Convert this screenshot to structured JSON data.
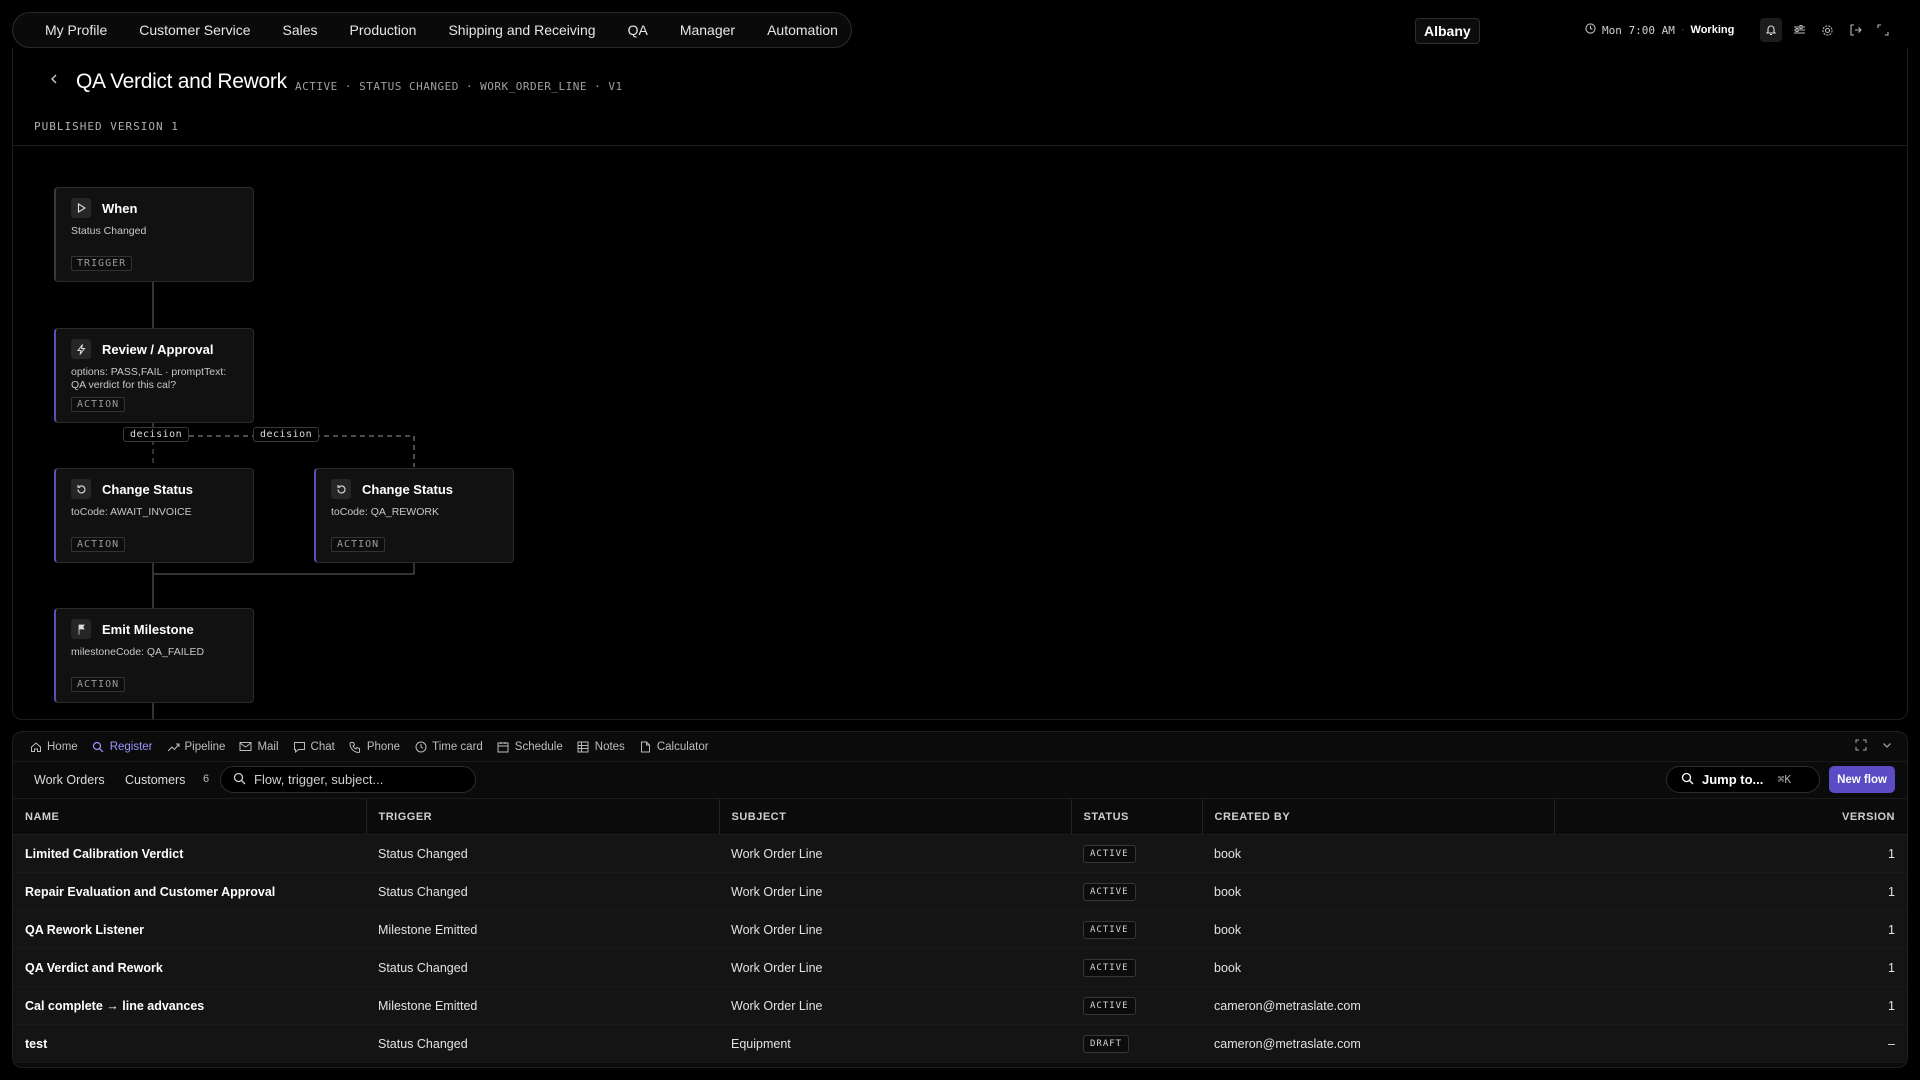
{
  "topnav": {
    "items": [
      "My Profile",
      "Customer Service",
      "Sales",
      "Production",
      "Shipping and Receiving",
      "QA",
      "Manager",
      "Automation"
    ],
    "location": "Albany",
    "clock": "Mon 7:00 AM",
    "separator": "·",
    "shift_status": "Working"
  },
  "flow": {
    "title": "QA Verdict and Rework",
    "meta": "ACTIVE · STATUS CHANGED · WORK_ORDER_LINE · V1",
    "published": "PUBLISHED VERSION 1",
    "nodes": [
      {
        "title": "When",
        "desc": "Status Changed",
        "tag": "TRIGGER",
        "icon": "play-icon"
      },
      {
        "title": "Review / Approval",
        "desc": "options: PASS,FAIL · promptText: QA verdict for this cal?",
        "tag": "ACTION",
        "icon": "bolt-icon"
      },
      {
        "title": "Change Status",
        "desc": "toCode: AWAIT_INVOICE",
        "tag": "ACTION",
        "icon": "refresh-icon"
      },
      {
        "title": "Change Status",
        "desc": "toCode: QA_REWORK",
        "tag": "ACTION",
        "icon": "refresh-icon"
      },
      {
        "title": "Emit Milestone",
        "desc": "milestoneCode: QA_FAILED",
        "tag": "ACTION",
        "icon": "flag-icon"
      }
    ],
    "edge_labels": [
      "decision",
      "decision"
    ]
  },
  "dock": {
    "tabs": [
      {
        "label": "Home",
        "icon": "home-icon"
      },
      {
        "label": "Register",
        "icon": "search-icon"
      },
      {
        "label": "Pipeline",
        "icon": "trend-icon"
      },
      {
        "label": "Mail",
        "icon": "mail-icon"
      },
      {
        "label": "Chat",
        "icon": "chat-icon"
      },
      {
        "label": "Phone",
        "icon": "phone-icon"
      },
      {
        "label": "Time card",
        "icon": "clock-icon"
      },
      {
        "label": "Schedule",
        "icon": "calendar-icon"
      },
      {
        "label": "Notes",
        "icon": "grid-icon"
      },
      {
        "label": "Calculator",
        "icon": "file-icon"
      }
    ],
    "active_tab": "Register",
    "filters": [
      "Work Orders",
      "Customers"
    ],
    "count": "6",
    "search_placeholder": "Flow, trigger, subject...",
    "jump_label": "Jump to...",
    "jump_shortcut": "⌘K",
    "new_flow_label": "New flow",
    "accent_color": "#5b4bc4"
  },
  "table": {
    "headers": [
      "NAME",
      "TRIGGER",
      "SUBJECT",
      "STATUS",
      "CREATED BY",
      "VERSION"
    ],
    "rows": [
      {
        "name": "Limited Calibration Verdict",
        "trigger": "Status Changed",
        "subject": "Work Order Line",
        "status": "ACTIVE",
        "created_by": "book",
        "version": "1"
      },
      {
        "name": "Repair Evaluation and Customer Approval",
        "trigger": "Status Changed",
        "subject": "Work Order Line",
        "status": "ACTIVE",
        "created_by": "book",
        "version": "1"
      },
      {
        "name": "QA Rework Listener",
        "trigger": "Milestone Emitted",
        "subject": "Work Order Line",
        "status": "ACTIVE",
        "created_by": "book",
        "version": "1"
      },
      {
        "name": "QA Verdict and Rework",
        "trigger": "Status Changed",
        "subject": "Work Order Line",
        "status": "ACTIVE",
        "created_by": "book",
        "version": "1"
      },
      {
        "name": "Cal complete → line advances",
        "trigger": "Milestone Emitted",
        "subject": "Work Order Line",
        "status": "ACTIVE",
        "created_by": "cameron@metraslate.com",
        "version": "1"
      },
      {
        "name": "test",
        "trigger": "Status Changed",
        "subject": "Equipment",
        "status": "DRAFT",
        "created_by": "cameron@metraslate.com",
        "version": "–"
      }
    ]
  }
}
